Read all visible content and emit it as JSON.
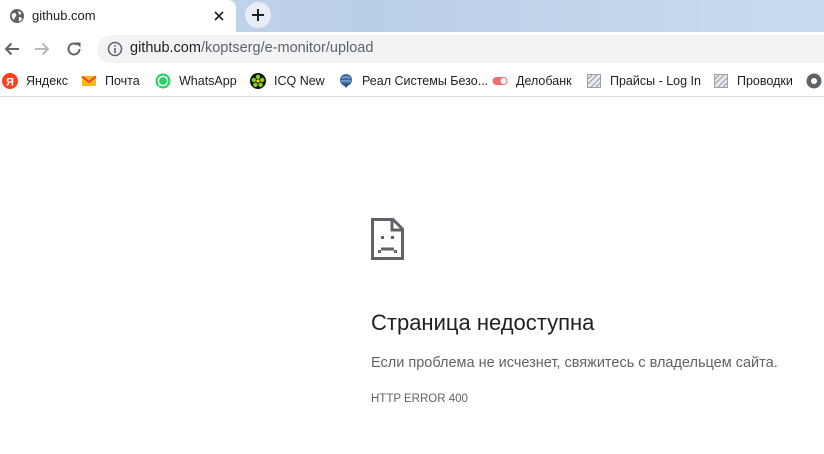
{
  "tab": {
    "title": "github.com",
    "new_tab_glyph": "+"
  },
  "toolbar": {
    "url_host": "github.com",
    "url_path": "/koptserg/e-monitor/upload"
  },
  "bookmarks": [
    {
      "label": "Яндекс",
      "icon": "yandex-icon"
    },
    {
      "label": "Почта",
      "icon": "mail-icon"
    },
    {
      "label": "WhatsApp",
      "icon": "whatsapp-icon"
    },
    {
      "label": "ICQ New",
      "icon": "icq-icon"
    },
    {
      "label": "Реал Системы Безо...",
      "icon": "globe-shield-icon"
    },
    {
      "label": "Делобанк",
      "icon": "toggle-icon"
    },
    {
      "label": "Прайсы - Log In",
      "icon": "broken-page-icon"
    },
    {
      "label": "Проводки",
      "icon": "broken-page-icon"
    }
  ],
  "error": {
    "title": "Страница недоступна",
    "description": "Если проблема не исчезнет, свяжитесь с владельцем сайта.",
    "code": "HTTP ERROR 400"
  },
  "colors": {
    "tabstrip": "#c7d9ec",
    "omnibox_bg": "#f1f3f4",
    "text_primary": "#202124",
    "text_secondary": "#5f6368"
  }
}
